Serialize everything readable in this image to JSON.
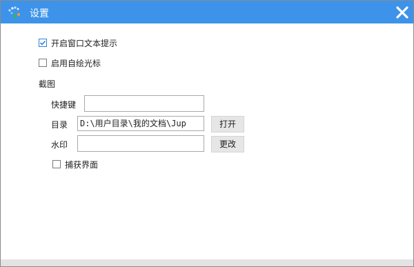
{
  "window": {
    "title": "设置"
  },
  "options": {
    "show_window_text_tips": {
      "label": "开启窗口文本提示",
      "checked": true
    },
    "enable_draw_cursor": {
      "label": "启用自绘光标",
      "checked": false
    }
  },
  "screenshot": {
    "section_label": "截图",
    "hotkey": {
      "label": "快捷键",
      "value": ""
    },
    "directory": {
      "label": "目录",
      "value": "D:\\用户目录\\我的文档\\Jup",
      "open_button": "打开"
    },
    "watermark": {
      "label": "水印",
      "value": "",
      "change_button": "更改"
    },
    "capture_interface": {
      "label": "捕获界面",
      "checked": false
    }
  },
  "colors": {
    "titlebar": "#3d93e9",
    "accent": "#2f7fd8"
  },
  "icons": {
    "app": "sparkle-icon",
    "close": "close-icon"
  }
}
